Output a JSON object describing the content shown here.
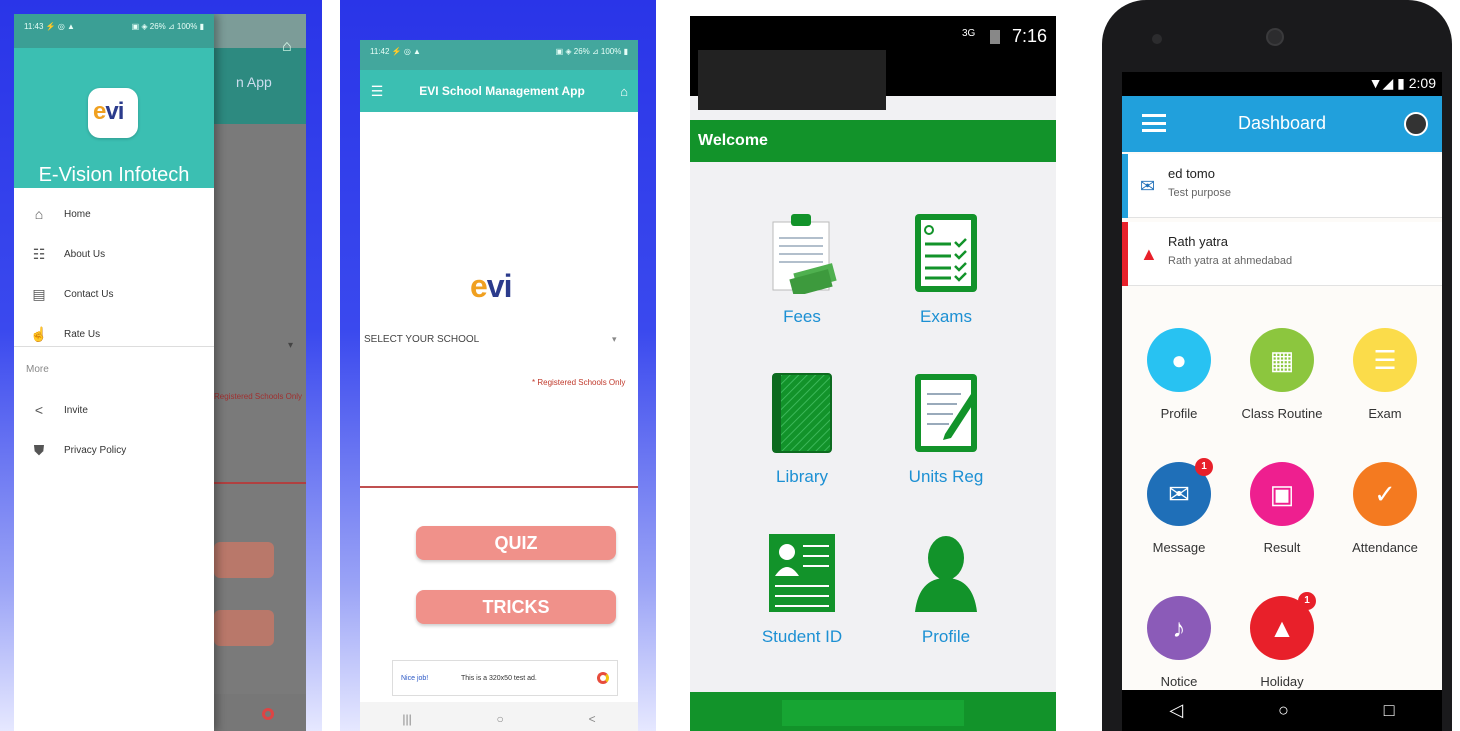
{
  "screen1": {
    "status_left": "11:43 ⚡ ◎ ▲",
    "status_right": "▣ ◈ 26% ⊿ 100% ▮",
    "bg_toolbar_text": "n App",
    "bg_error_text": "Registered Schools Only",
    "app_name": "E-Vision Infotech",
    "logo_text_e": "e",
    "logo_text_vi": "vi",
    "menu": [
      {
        "label": "Home",
        "icon": "home-icon",
        "glyph": "⌂"
      },
      {
        "label": "About Us",
        "icon": "people-icon",
        "glyph": "☷"
      },
      {
        "label": "Contact Us",
        "icon": "contact-icon",
        "glyph": "▤"
      },
      {
        "label": "Rate Us",
        "icon": "thumb-up-icon",
        "glyph": "☝"
      }
    ],
    "section_label": "More",
    "more_menu": [
      {
        "label": "Invite",
        "icon": "share-icon",
        "glyph": "<"
      },
      {
        "label": "Privacy Policy",
        "icon": "shield-icon",
        "glyph": "⛊"
      }
    ]
  },
  "screen2": {
    "status_left": "11:42 ⚡ ◎ ▲",
    "status_right": "▣ ◈ 26% ⊿ 100% ▮",
    "title": "EVI School Management App",
    "select_label": "SELECT YOUR SCHOOL",
    "select_arrow": "▾",
    "registered_note": "* Registered Schools Only",
    "buttons": {
      "quiz": "QUIZ",
      "tricks": "TRICKS"
    },
    "ad": {
      "nice": "Nice job!",
      "text": "This is a 320x50 test ad."
    },
    "nav": [
      "|||",
      "○",
      "<"
    ]
  },
  "screen3": {
    "clock": "7:16",
    "network": "3G",
    "welcome": "Welcome",
    "items": [
      {
        "label": "Fees",
        "icon": "fees-clipboard-icon"
      },
      {
        "label": "Exams",
        "icon": "exams-checklist-icon"
      },
      {
        "label": "Library",
        "icon": "library-book-icon"
      },
      {
        "label": "Units Reg",
        "icon": "units-reg-form-icon"
      },
      {
        "label": "Student ID",
        "icon": "student-id-card-icon"
      },
      {
        "label": "Profile",
        "icon": "profile-person-icon"
      }
    ],
    "colors": {
      "green": "#12932a",
      "label": "#1c90d3"
    }
  },
  "screen4": {
    "status": "▼◢ ▮ 2:09",
    "title": "Dashboard",
    "notices": [
      {
        "title": "ed tomo",
        "sub": "Test purpose",
        "icon": "mail-icon",
        "color": "#21a0dc"
      },
      {
        "title": "Rath yatra",
        "sub": "Rath yatra at ahmedabad",
        "icon": "santa-hat-icon",
        "color": "#e8202a"
      }
    ],
    "tiles": [
      {
        "label": "Profile",
        "color": "#28c2f2",
        "glyph": "👤",
        "badge": ""
      },
      {
        "label": "Class Routine",
        "color": "#8cc63e",
        "glyph": "▦",
        "badge": ""
      },
      {
        "label": "Exam",
        "color": "#fbdc4a",
        "glyph": "☰",
        "badge": ""
      },
      {
        "label": "Message",
        "color": "#1f6fb8",
        "glyph": "✉",
        "badge": "1"
      },
      {
        "label": "Result",
        "color": "#ee1f8f",
        "glyph": "▣",
        "badge": ""
      },
      {
        "label": "Attendance",
        "color": "#f47a20",
        "glyph": "✓",
        "badge": ""
      },
      {
        "label": "Notice",
        "color": "#8b5bb8",
        "glyph": "🔔",
        "badge": ""
      },
      {
        "label": "Holiday",
        "color": "#e8202a",
        "glyph": "▲",
        "badge": "1"
      }
    ],
    "nav": [
      "◁",
      "○",
      "□"
    ]
  }
}
